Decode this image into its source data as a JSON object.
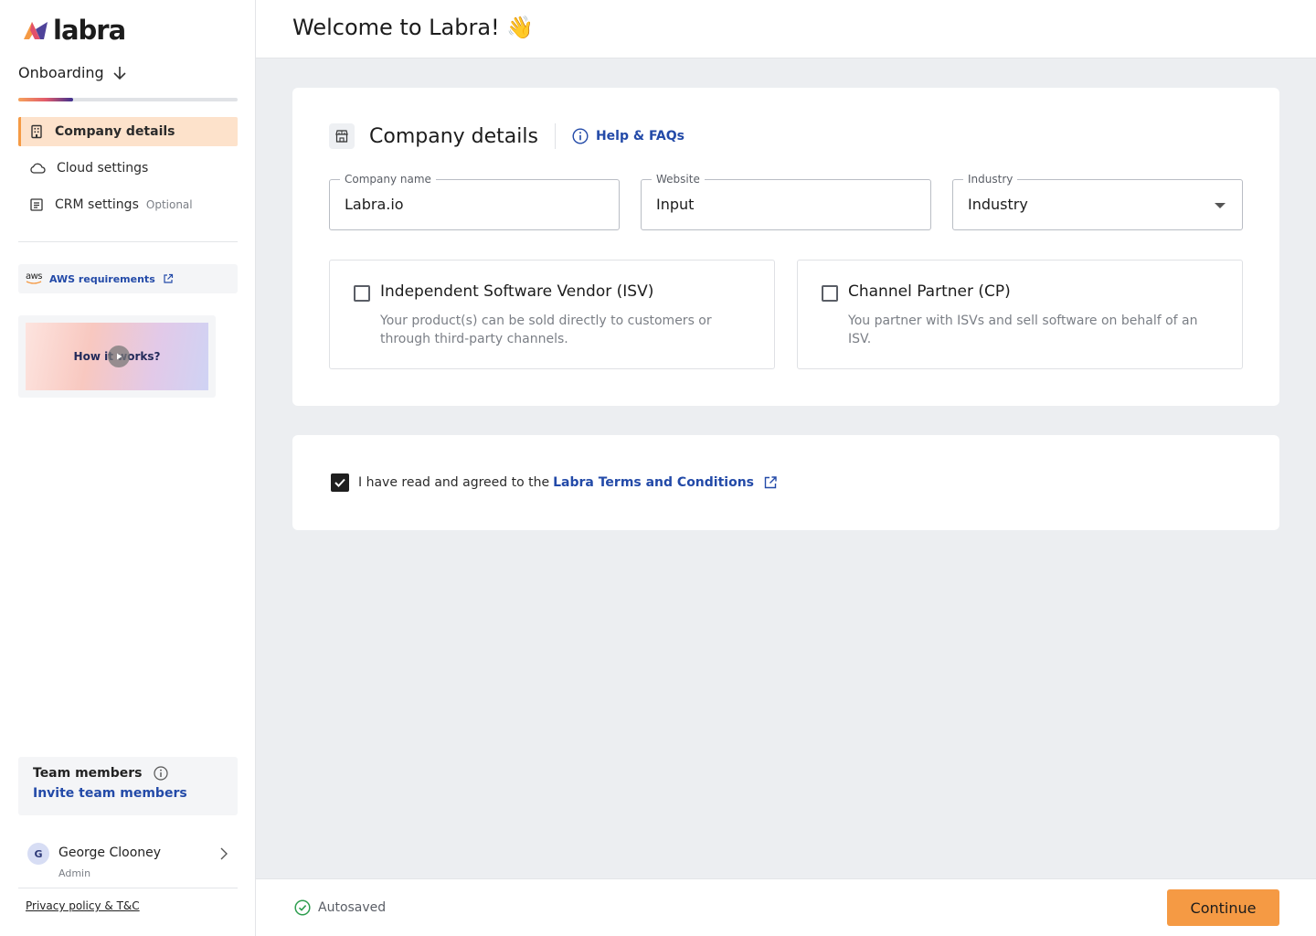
{
  "brand": {
    "name": "labra",
    "accent": "#f59a44",
    "link_color": "#234aa8"
  },
  "sidebar": {
    "section_title": "Onboarding",
    "progress_fraction": 0.25,
    "items": [
      {
        "label": "Company details",
        "active": true,
        "icon": "building-icon"
      },
      {
        "label": "Cloud settings",
        "active": false,
        "icon": "cloud-icon"
      },
      {
        "label": "CRM settings",
        "optional": "Optional",
        "active": false,
        "icon": "crm-icon"
      }
    ],
    "aws": {
      "logo": "aws",
      "label": "AWS requirements"
    },
    "video": {
      "label": "How it works?"
    },
    "team": {
      "title": "Team members",
      "link": "Invite team members"
    },
    "user": {
      "initial": "G",
      "name": "George Clooney",
      "role": "Admin"
    },
    "privacy": "Privacy policy & T&C"
  },
  "header": {
    "title": "Welcome to Labra!",
    "emoji": "👋"
  },
  "company_card": {
    "title": "Company details",
    "help": "Help & FAQs",
    "fields": {
      "company_name": {
        "label": "Company name",
        "value": "Labra.io"
      },
      "website": {
        "label": "Website",
        "value": "Input"
      },
      "industry": {
        "label": "Industry",
        "value": "Industry"
      }
    },
    "options": [
      {
        "title": "Independent Software Vendor (ISV)",
        "desc": "Your product(s) can be sold directly to customers or through third-party channels.",
        "checked": false
      },
      {
        "title": "Channel Partner (CP)",
        "desc": "You partner with ISVs and sell software on behalf of an ISV.",
        "checked": false
      }
    ]
  },
  "terms": {
    "text": "I have read and agreed to the",
    "link": "Labra Terms and Conditions",
    "checked": true
  },
  "footer": {
    "status": "Autosaved",
    "continue_label": "Continue"
  }
}
